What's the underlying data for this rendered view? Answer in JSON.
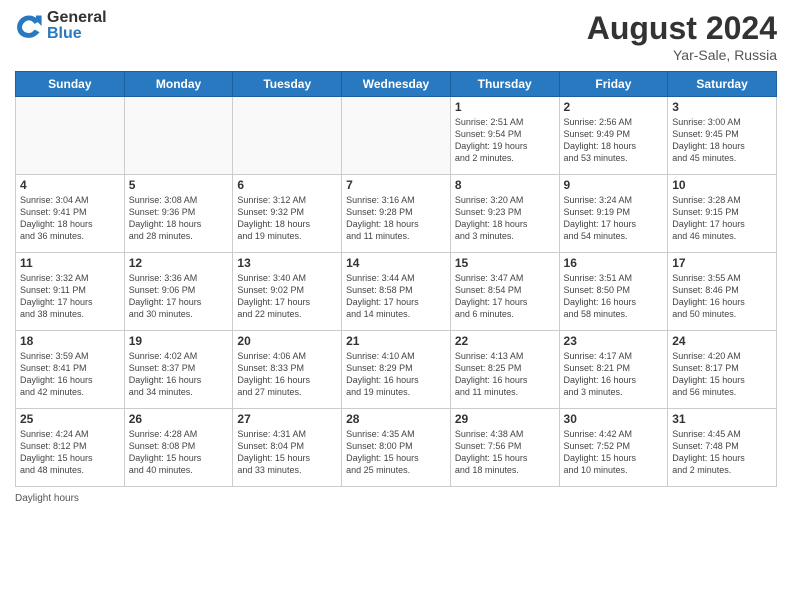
{
  "logo": {
    "general": "General",
    "blue": "Blue"
  },
  "title": {
    "month_year": "August 2024",
    "location": "Yar-Sale, Russia"
  },
  "days_of_week": [
    "Sunday",
    "Monday",
    "Tuesday",
    "Wednesday",
    "Thursday",
    "Friday",
    "Saturday"
  ],
  "weeks": [
    [
      {
        "day": "",
        "info": ""
      },
      {
        "day": "",
        "info": ""
      },
      {
        "day": "",
        "info": ""
      },
      {
        "day": "",
        "info": ""
      },
      {
        "day": "1",
        "info": "Sunrise: 2:51 AM\nSunset: 9:54 PM\nDaylight: 19 hours\nand 2 minutes."
      },
      {
        "day": "2",
        "info": "Sunrise: 2:56 AM\nSunset: 9:49 PM\nDaylight: 18 hours\nand 53 minutes."
      },
      {
        "day": "3",
        "info": "Sunrise: 3:00 AM\nSunset: 9:45 PM\nDaylight: 18 hours\nand 45 minutes."
      }
    ],
    [
      {
        "day": "4",
        "info": "Sunrise: 3:04 AM\nSunset: 9:41 PM\nDaylight: 18 hours\nand 36 minutes."
      },
      {
        "day": "5",
        "info": "Sunrise: 3:08 AM\nSunset: 9:36 PM\nDaylight: 18 hours\nand 28 minutes."
      },
      {
        "day": "6",
        "info": "Sunrise: 3:12 AM\nSunset: 9:32 PM\nDaylight: 18 hours\nand 19 minutes."
      },
      {
        "day": "7",
        "info": "Sunrise: 3:16 AM\nSunset: 9:28 PM\nDaylight: 18 hours\nand 11 minutes."
      },
      {
        "day": "8",
        "info": "Sunrise: 3:20 AM\nSunset: 9:23 PM\nDaylight: 18 hours\nand 3 minutes."
      },
      {
        "day": "9",
        "info": "Sunrise: 3:24 AM\nSunset: 9:19 PM\nDaylight: 17 hours\nand 54 minutes."
      },
      {
        "day": "10",
        "info": "Sunrise: 3:28 AM\nSunset: 9:15 PM\nDaylight: 17 hours\nand 46 minutes."
      }
    ],
    [
      {
        "day": "11",
        "info": "Sunrise: 3:32 AM\nSunset: 9:11 PM\nDaylight: 17 hours\nand 38 minutes."
      },
      {
        "day": "12",
        "info": "Sunrise: 3:36 AM\nSunset: 9:06 PM\nDaylight: 17 hours\nand 30 minutes."
      },
      {
        "day": "13",
        "info": "Sunrise: 3:40 AM\nSunset: 9:02 PM\nDaylight: 17 hours\nand 22 minutes."
      },
      {
        "day": "14",
        "info": "Sunrise: 3:44 AM\nSunset: 8:58 PM\nDaylight: 17 hours\nand 14 minutes."
      },
      {
        "day": "15",
        "info": "Sunrise: 3:47 AM\nSunset: 8:54 PM\nDaylight: 17 hours\nand 6 minutes."
      },
      {
        "day": "16",
        "info": "Sunrise: 3:51 AM\nSunset: 8:50 PM\nDaylight: 16 hours\nand 58 minutes."
      },
      {
        "day": "17",
        "info": "Sunrise: 3:55 AM\nSunset: 8:46 PM\nDaylight: 16 hours\nand 50 minutes."
      }
    ],
    [
      {
        "day": "18",
        "info": "Sunrise: 3:59 AM\nSunset: 8:41 PM\nDaylight: 16 hours\nand 42 minutes."
      },
      {
        "day": "19",
        "info": "Sunrise: 4:02 AM\nSunset: 8:37 PM\nDaylight: 16 hours\nand 34 minutes."
      },
      {
        "day": "20",
        "info": "Sunrise: 4:06 AM\nSunset: 8:33 PM\nDaylight: 16 hours\nand 27 minutes."
      },
      {
        "day": "21",
        "info": "Sunrise: 4:10 AM\nSunset: 8:29 PM\nDaylight: 16 hours\nand 19 minutes."
      },
      {
        "day": "22",
        "info": "Sunrise: 4:13 AM\nSunset: 8:25 PM\nDaylight: 16 hours\nand 11 minutes."
      },
      {
        "day": "23",
        "info": "Sunrise: 4:17 AM\nSunset: 8:21 PM\nDaylight: 16 hours\nand 3 minutes."
      },
      {
        "day": "24",
        "info": "Sunrise: 4:20 AM\nSunset: 8:17 PM\nDaylight: 15 hours\nand 56 minutes."
      }
    ],
    [
      {
        "day": "25",
        "info": "Sunrise: 4:24 AM\nSunset: 8:12 PM\nDaylight: 15 hours\nand 48 minutes."
      },
      {
        "day": "26",
        "info": "Sunrise: 4:28 AM\nSunset: 8:08 PM\nDaylight: 15 hours\nand 40 minutes."
      },
      {
        "day": "27",
        "info": "Sunrise: 4:31 AM\nSunset: 8:04 PM\nDaylight: 15 hours\nand 33 minutes."
      },
      {
        "day": "28",
        "info": "Sunrise: 4:35 AM\nSunset: 8:00 PM\nDaylight: 15 hours\nand 25 minutes."
      },
      {
        "day": "29",
        "info": "Sunrise: 4:38 AM\nSunset: 7:56 PM\nDaylight: 15 hours\nand 18 minutes."
      },
      {
        "day": "30",
        "info": "Sunrise: 4:42 AM\nSunset: 7:52 PM\nDaylight: 15 hours\nand 10 minutes."
      },
      {
        "day": "31",
        "info": "Sunrise: 4:45 AM\nSunset: 7:48 PM\nDaylight: 15 hours\nand 2 minutes."
      }
    ]
  ],
  "footer": {
    "note": "Daylight hours"
  }
}
